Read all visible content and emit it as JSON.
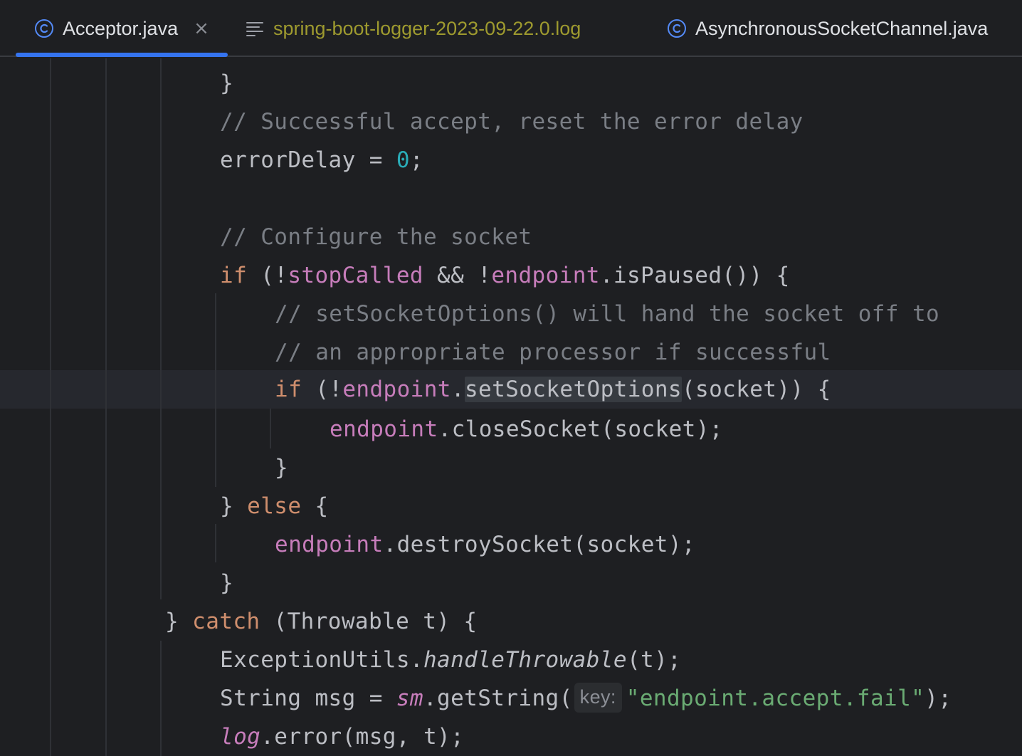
{
  "tabs": [
    {
      "label": "Acceptor.java",
      "icon": "class-icon",
      "active": true,
      "closable": true,
      "color": "#dfe1e5"
    },
    {
      "label": "spring-boot-logger-2023-09-22.0.log",
      "icon": "log-file-icon",
      "active": false,
      "color": "#9e9a2f"
    },
    {
      "label": "AsynchronousSocketChannel.java",
      "icon": "class-icon",
      "active": false,
      "color": "#dfe1e5"
    }
  ],
  "close_glyph": "×",
  "colors": {
    "accent": "#3574f0",
    "keyword": "#cf8e6d",
    "field": "#c77dbb",
    "number": "#2aacb8",
    "comment": "#7a7e85",
    "string": "#6aab73",
    "text": "#bcbec4",
    "background": "#1e1f22"
  },
  "code": {
    "l1": "}",
    "l2": "// Successful accept, reset the error delay",
    "l3a": "errorDelay = ",
    "l3b": "0",
    "l3c": ";",
    "l5": "// Configure the socket",
    "l6a": "if",
    "l6b": " (!",
    "l6c": "stopCalled",
    "l6d": " && !",
    "l6e": "endpoint",
    "l6f": ".isPaused()) {",
    "l7": "// setSocketOptions() will hand the socket off to",
    "l8": "// an appropriate processor if successful",
    "l9a": "if",
    "l9b": " (!",
    "l9c": "endpoint",
    "l9d": ".",
    "l9e": "setSocketOptions",
    "l9f": "(socket)) {",
    "l10a": "endpoint",
    "l10b": ".closeSocket(socket);",
    "l11": "}",
    "l12a": "} ",
    "l12b": "else",
    "l12c": " {",
    "l13a": "endpoint",
    "l13b": ".destroySocket(socket);",
    "l14": "}",
    "l15a": "} ",
    "l15b": "catch",
    "l15c": " (Throwable t) {",
    "l16a": "ExceptionUtils.",
    "l16b": "handleThrowable",
    "l16c": "(t);",
    "l17a": "String msg = ",
    "l17b": "sm",
    "l17c": ".getString(",
    "l17hint": "key:",
    "l17d": "\"endpoint.accept.fail\"",
    "l17e": ");",
    "l18a": "log",
    "l18b": ".error(msg, t);"
  }
}
